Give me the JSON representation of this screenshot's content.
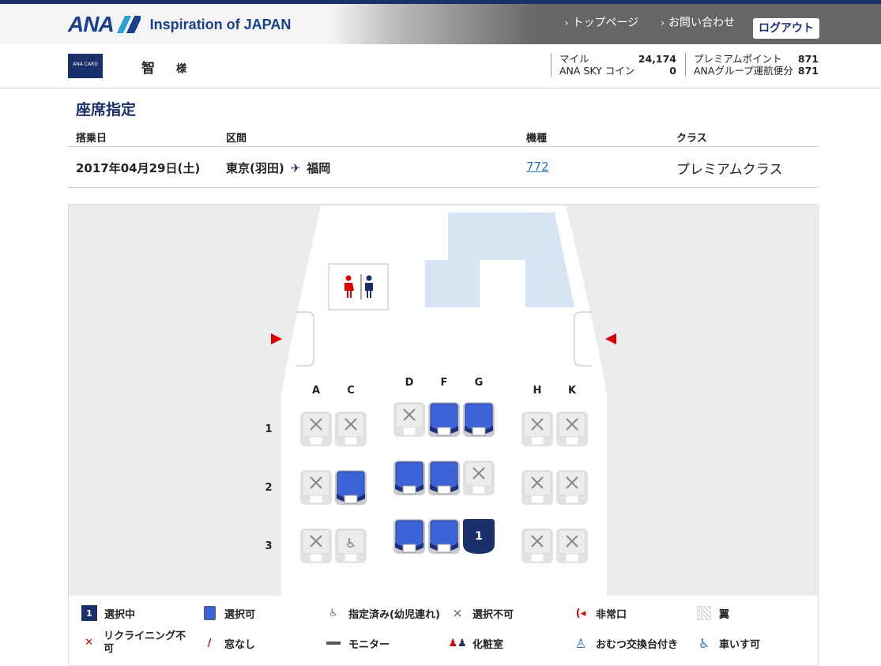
{
  "header": {
    "brand": "ANA",
    "tagline": "Inspiration of JAPAN",
    "nav": [
      "トップページ",
      "お問い合わせ"
    ],
    "logout_label": "ログアウト"
  },
  "member": {
    "card_label": "ANA CARD",
    "name": "智",
    "honorific": "様",
    "stats": [
      {
        "label": "マイル",
        "value": "24,174"
      },
      {
        "label": "ANA SKY コイン",
        "value": "0"
      },
      {
        "label": "プレミアムポイント",
        "value": "871"
      },
      {
        "label": "ANAグループ運航便分",
        "value": "871"
      }
    ]
  },
  "page_title": "座席指定",
  "flight": {
    "headers": {
      "date": "搭乗日",
      "route": "区間",
      "aircraft": "機種",
      "class": "クラス"
    },
    "date": "2017年04月29日(土)",
    "origin": "東京(羽田)",
    "destination": "福岡",
    "aircraft": "772",
    "class": "プレミアムクラス"
  },
  "seatmap": {
    "columns_left": [
      "A",
      "C"
    ],
    "columns_center": [
      "D",
      "F",
      "G"
    ],
    "columns_right": [
      "H",
      "K"
    ],
    "rows": [
      {
        "num": "1",
        "seats": {
          "A": "unavailable",
          "C": "unavailable",
          "D": "unavailable",
          "F": "available",
          "G": "available",
          "H": "unavailable",
          "K": "unavailable"
        }
      },
      {
        "num": "2",
        "seats": {
          "A": "unavailable",
          "C": "available",
          "D": "available",
          "F": "available",
          "G": "unavailable",
          "H": "unavailable",
          "K": "unavailable"
        }
      },
      {
        "num": "3",
        "seats": {
          "A": "unavailable",
          "C": "infant",
          "D": "available",
          "F": "available",
          "G": "selected",
          "H": "unavailable",
          "K": "unavailable"
        }
      }
    ],
    "selected_seat_label": "1",
    "colors": {
      "available": "#3c63d8",
      "selected": "#1b2f6a",
      "unavailable": "#e2e2e2",
      "wing": "#d7e4f4",
      "exit": "#d00000"
    }
  },
  "legend": {
    "selected_badge": "1",
    "selected": "選択中",
    "available": "選択可",
    "infant": "指定済み(幼児連れ)",
    "unavailable": "選択不可",
    "exit": "非常口",
    "wing": "翼",
    "no_recline": "リクライニング不可",
    "no_window": "窓なし",
    "monitor": "モニター",
    "lavatory": "化粧室",
    "diaper": "おむつ交換台付き",
    "wheelchair": "車いす可"
  }
}
